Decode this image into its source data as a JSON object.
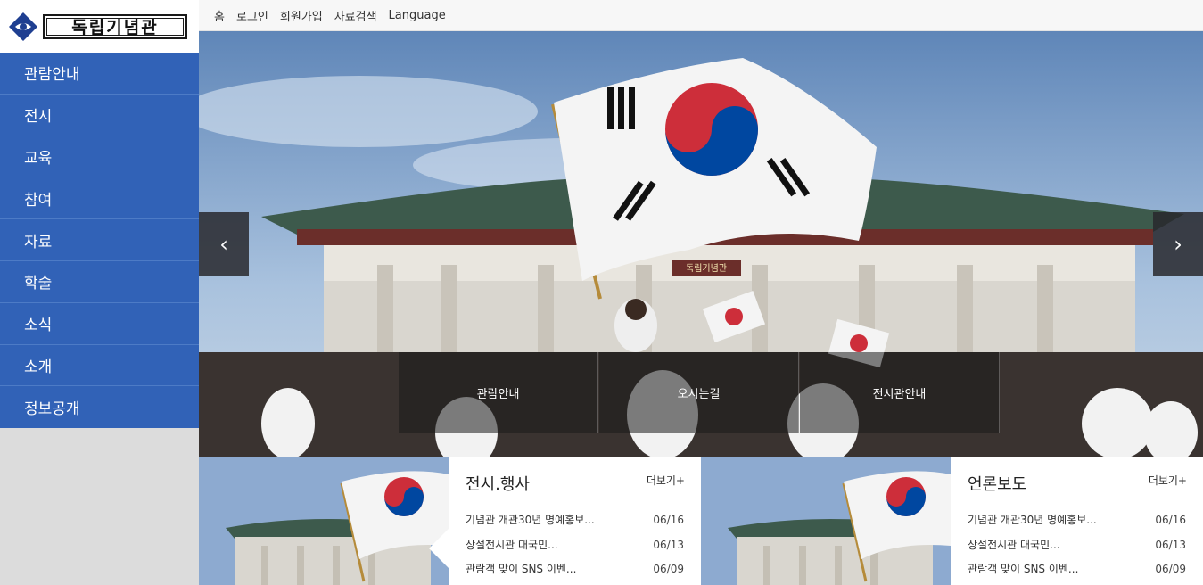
{
  "logo": {
    "text": "독립기념관",
    "brand_color": "#1f3f91"
  },
  "sidebar": {
    "color": "#3162b7",
    "items": [
      {
        "label": "관람안내"
      },
      {
        "label": "전시"
      },
      {
        "label": "교육"
      },
      {
        "label": "참여"
      },
      {
        "label": "자료"
      },
      {
        "label": "학술"
      },
      {
        "label": "소식"
      },
      {
        "label": "소개"
      },
      {
        "label": "정보공개"
      }
    ]
  },
  "topbar": {
    "links": [
      {
        "label": "홈"
      },
      {
        "label": "로그인"
      },
      {
        "label": "회원가입"
      },
      {
        "label": "자료검색"
      },
      {
        "label": "Language"
      }
    ]
  },
  "hero": {
    "prev_icon": "chevron-left-icon",
    "next_icon": "chevron-right-icon",
    "prev_glyph": "‹",
    "next_glyph": "›",
    "building_sign": "독립기념관",
    "quick_links": [
      {
        "label": "관람안내"
      },
      {
        "label": "오시는길"
      },
      {
        "label": "전시관안내"
      }
    ]
  },
  "boards": [
    {
      "title": "전시.행사",
      "more": "더보기+",
      "items": [
        {
          "text": "기념관 개관30년 명예홍보...",
          "date": "06/16"
        },
        {
          "text": "상설전시관 대국민...",
          "date": "06/13"
        },
        {
          "text": "관람객 맞이 SNS 이벤...",
          "date": "06/09"
        }
      ]
    },
    {
      "title": "언론보도",
      "more": "더보기+",
      "items": [
        {
          "text": "기념관 개관30년 명예홍보...",
          "date": "06/16"
        },
        {
          "text": "상설전시관 대국민...",
          "date": "06/13"
        },
        {
          "text": "관람객 맞이 SNS 이벤...",
          "date": "06/09"
        }
      ]
    }
  ]
}
